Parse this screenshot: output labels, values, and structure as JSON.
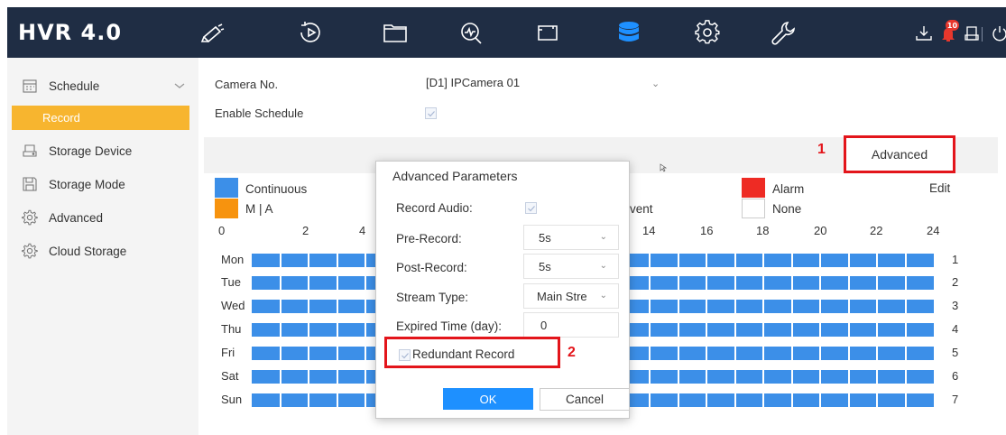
{
  "app": {
    "title": "HVR 4.0"
  },
  "topbar": {
    "nav": [
      {
        "icon": "live-view-camera-icon"
      },
      {
        "icon": "playback-icon"
      },
      {
        "icon": "file-management-icon"
      },
      {
        "icon": "smart-analysis-icon"
      },
      {
        "icon": "display-icon"
      },
      {
        "icon": "storage-database-icon",
        "active": true
      },
      {
        "icon": "system-settings-gear-icon"
      },
      {
        "icon": "maintenance-wrench-icon"
      }
    ],
    "alarm_count": "10",
    "colors": {
      "background": "#1f2d44",
      "active_icon": "#1e90ff",
      "badge": "#e8372c"
    }
  },
  "sidebar": {
    "items": [
      {
        "label": "Schedule",
        "icon": "schedule-calendar-icon",
        "expanded": true
      },
      {
        "label": "Record",
        "selected": true
      },
      {
        "label": "Storage Device",
        "icon": "storage-device-icon"
      },
      {
        "label": "Storage Mode",
        "icon": "storage-mode-disk-icon"
      },
      {
        "label": "Advanced",
        "icon": "advanced-gear-icon"
      },
      {
        "label": "Cloud Storage",
        "icon": "cloud-storage-gear-icon"
      }
    ],
    "colors": {
      "selected": "#f7b52f"
    }
  },
  "form": {
    "camera_label": "Camera No.",
    "camera_value": "[D1] IPCamera 01",
    "enable_label": "Enable Schedule",
    "enable_checked": true
  },
  "toolbar": {
    "advanced_label": "Advanced",
    "annotation_1": "1"
  },
  "legend": {
    "continuous": "Continuous",
    "mia": "M | A",
    "event": "vent",
    "alarm": "Alarm",
    "none": "None",
    "edit": "Edit",
    "colors": {
      "continuous": "#3c8fe8",
      "mia": "#f7930e",
      "alarm": "#ee2b24",
      "none": "#ffffff"
    }
  },
  "schedule": {
    "hours_left": [
      "0",
      "2",
      "4"
    ],
    "hours_right": [
      "14",
      "16",
      "18",
      "20",
      "22",
      "24"
    ],
    "days": [
      {
        "name": "Mon",
        "num": "1"
      },
      {
        "name": "Tue",
        "num": "2"
      },
      {
        "name": "Wed",
        "num": "3"
      },
      {
        "name": "Thu",
        "num": "4"
      },
      {
        "name": "Fri",
        "num": "5"
      },
      {
        "name": "Sat",
        "num": "6"
      },
      {
        "name": "Sun",
        "num": "7"
      }
    ],
    "fill_type": "continuous"
  },
  "dialog": {
    "title": "Advanced Parameters",
    "record_audio_label": "Record Audio:",
    "record_audio_checked": true,
    "pre_record_label": "Pre-Record:",
    "pre_record_value": "5s",
    "post_record_label": "Post-Record:",
    "post_record_value": "5s",
    "stream_type_label": "Stream Type:",
    "stream_type_value": "Main Stre",
    "expired_label": "Expired Time (day):",
    "expired_value": "0",
    "redundant_label": "Redundant Record",
    "redundant_checked": true,
    "annotation_2": "2",
    "ok_label": "OK",
    "cancel_label": "Cancel"
  }
}
